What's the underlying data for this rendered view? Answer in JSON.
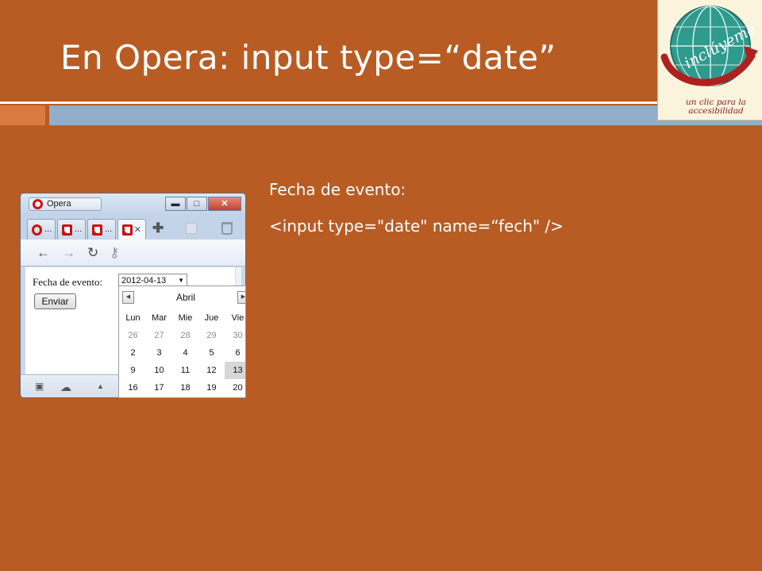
{
  "slide": {
    "title": "En Opera: input type=“date”",
    "label_text": "Fecha de evento:",
    "code_text": "<input type=\"date\" name=“fech\" />"
  },
  "logo": {
    "brand": "inclúyeme",
    "tagline": "un clic para la accesibilidad"
  },
  "browser": {
    "menu_label": "Opera",
    "tabs": [
      {
        "label": "...",
        "icon": "opera-icon"
      },
      {
        "label": "...",
        "icon": "document-icon"
      },
      {
        "label": "...",
        "icon": "document-icon"
      },
      {
        "label": "",
        "icon": "document-icon",
        "active": true
      }
    ],
    "win_buttons": {
      "minimize": "▬",
      "maximize": "□",
      "close": "✕"
    },
    "form": {
      "label": "Fecha de evento:",
      "date_value": "2012-04-13",
      "submit_label": "Enviar"
    }
  },
  "calendar": {
    "month": "Abril",
    "weekdays": [
      "Lun",
      "Mar",
      "Mie",
      "Jue",
      "Vie"
    ],
    "weeks": [
      [
        "26",
        "27",
        "28",
        "29",
        "30"
      ],
      [
        "2",
        "3",
        "4",
        "5",
        "6"
      ],
      [
        "9",
        "10",
        "11",
        "12",
        "13"
      ],
      [
        "16",
        "17",
        "18",
        "19",
        "20"
      ]
    ],
    "selected": "13",
    "dim_week_index": 0
  },
  "colors": {
    "background": "#b85c24",
    "accent_orange": "#d97a40",
    "accent_blue": "#92aec9"
  }
}
